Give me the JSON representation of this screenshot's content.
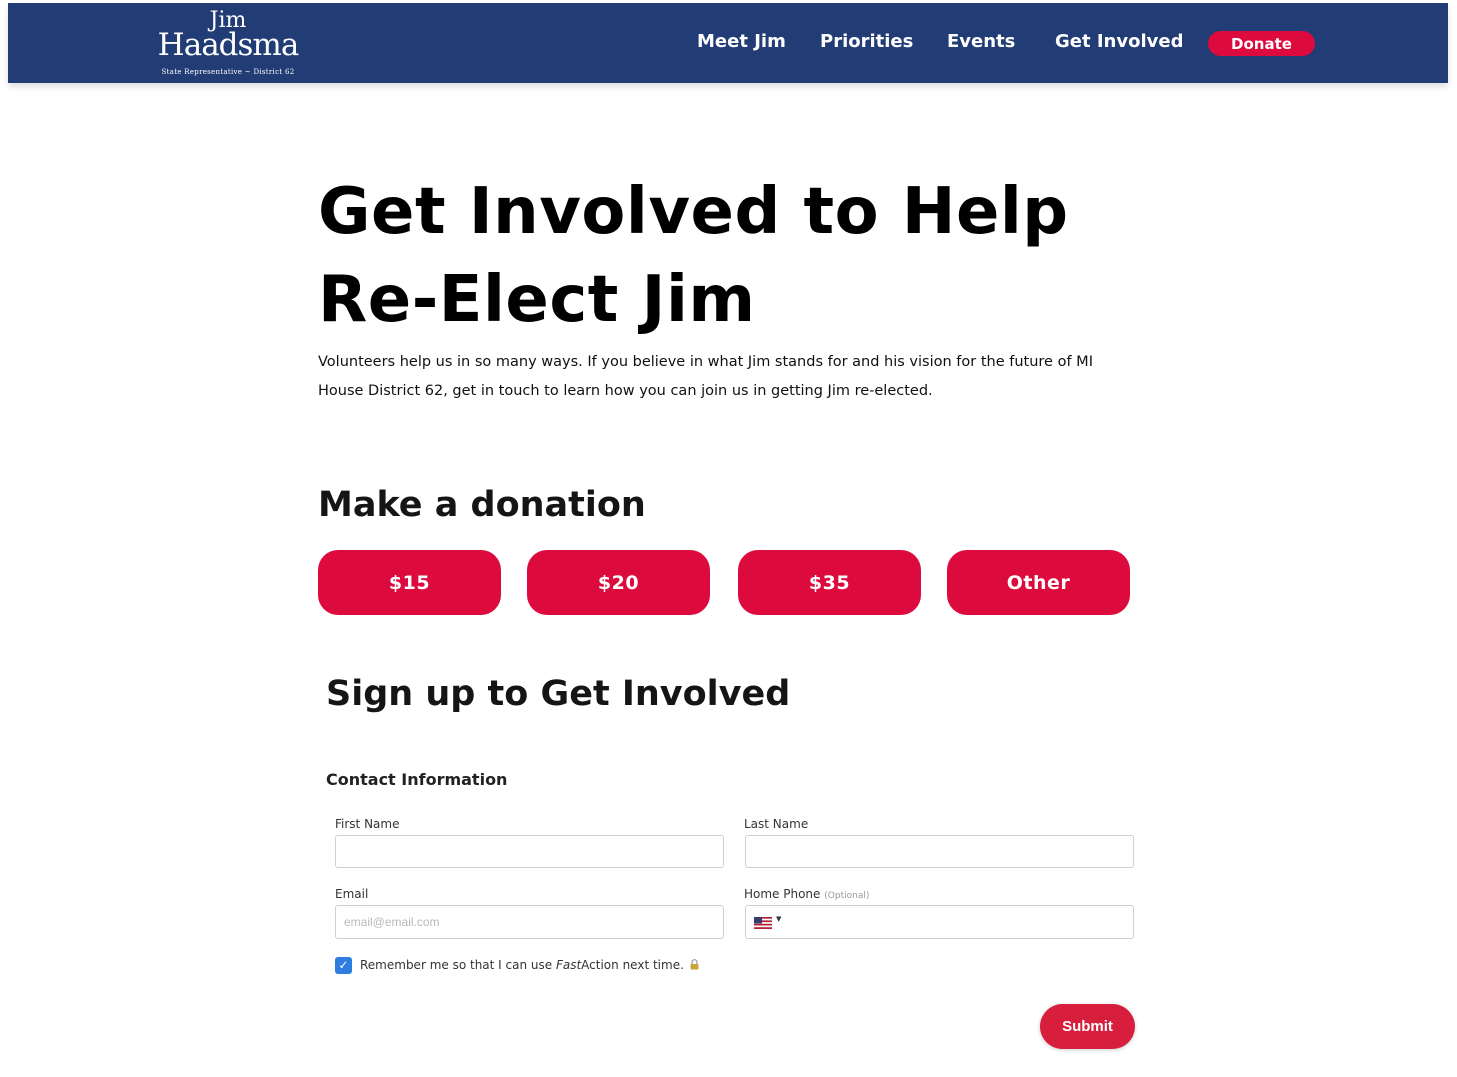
{
  "header": {
    "logo": {
      "first": "Jim",
      "last": "Haadsma",
      "subtitle": "State Representative ~ District 62"
    },
    "nav": [
      "Meet Jim",
      "Priorities",
      "Events",
      "Get Involved"
    ],
    "donate_label": "Donate"
  },
  "page": {
    "title": "Get Involved to Help Re-Elect Jim",
    "intro": "Volunteers help us in so many ways. If you believe in what Jim stands for and his vision for the future of MI House District 62, get in touch to learn how you can join us in getting Jim re-elected."
  },
  "donation": {
    "heading": "Make a donation",
    "amounts": [
      "$15",
      "$20",
      "$35",
      "Other"
    ]
  },
  "signup": {
    "heading": "Sign up to Get Involved",
    "section": "Contact Information",
    "first_name": {
      "label": "First Name",
      "value": ""
    },
    "last_name": {
      "label": "Last Name",
      "value": ""
    },
    "email": {
      "label": "Email",
      "placeholder": "email@email.com",
      "value": ""
    },
    "phone": {
      "label": "Home Phone",
      "optional": "(Optional)",
      "country": "us-flag-icon",
      "value": ""
    },
    "remember": {
      "checked": true,
      "prefix": "Remember me so that I can use ",
      "fast": "Fast",
      "action": "Action",
      "suffix": " next time."
    },
    "submit_label": "Submit"
  },
  "colors": {
    "header": "#223c75",
    "accent": "#dd0a3e",
    "checkbox": "#2f7de1"
  }
}
